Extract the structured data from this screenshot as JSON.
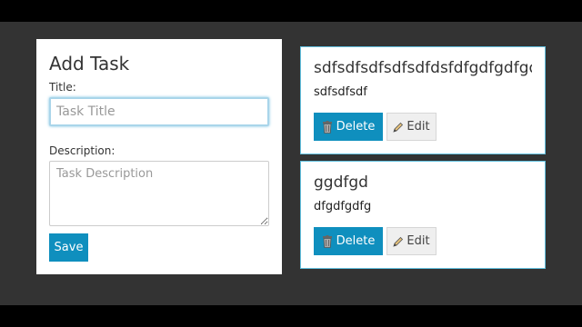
{
  "form": {
    "heading": "Add Task",
    "title_label": "Title:",
    "title_placeholder": "Task Title",
    "title_value": "",
    "description_label": "Description:",
    "description_placeholder": "Task Description",
    "description_value": "",
    "save_label": "Save"
  },
  "tasks": [
    {
      "title": "sdfsdfsdfsdfsdfdsfdfgdfgdfgdfg",
      "description": "sdfsdfsdf",
      "delete_label": "Delete",
      "edit_label": "Edit"
    },
    {
      "title": "ggdfgd",
      "description": "dfgdfgdfg",
      "delete_label": "Delete",
      "edit_label": "Edit"
    }
  ],
  "icons": {
    "delete": "trash-icon",
    "edit": "pencil-icon"
  },
  "colors": {
    "accent": "#0f8fbe",
    "card_border": "#63c1e0",
    "background": "#333333"
  }
}
